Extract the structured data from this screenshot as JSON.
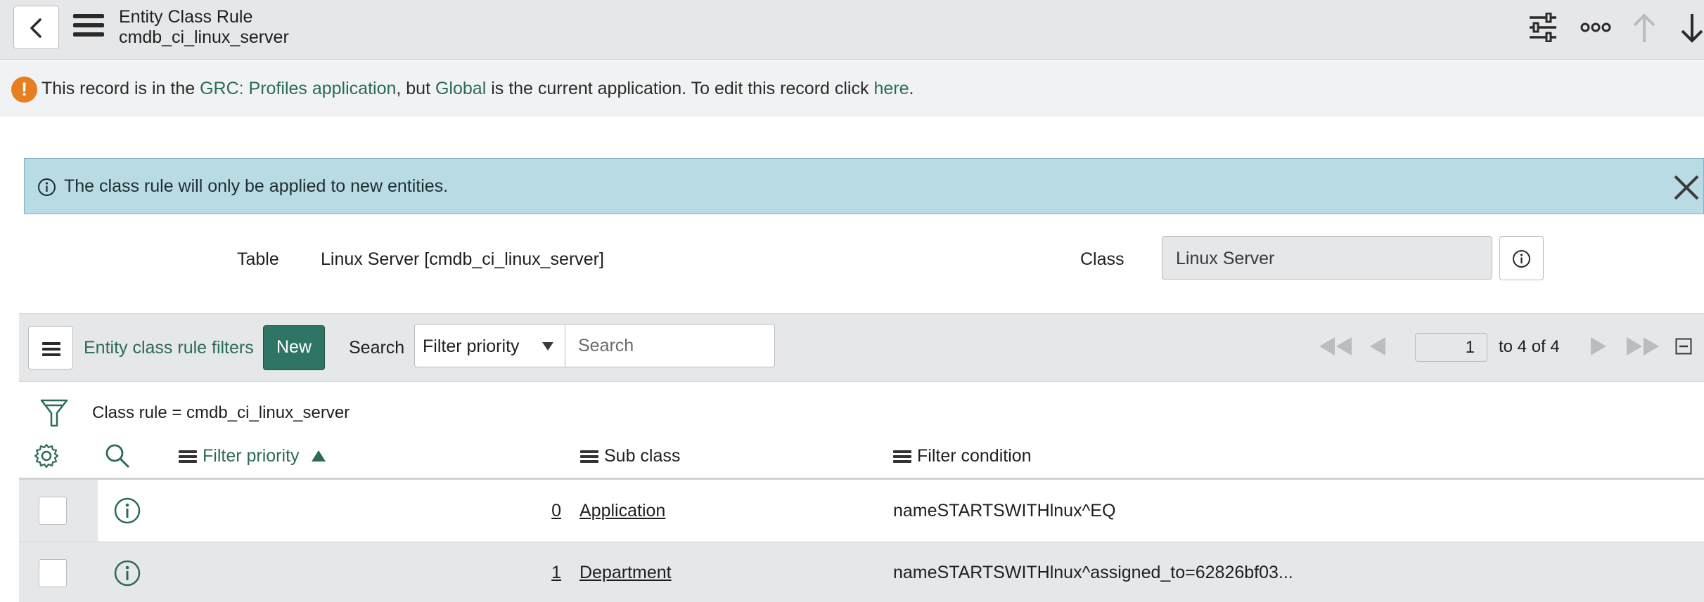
{
  "header": {
    "title": "Entity Class Rule",
    "subtitle": "cmdb_ci_linux_server"
  },
  "warning": {
    "prefix": "This record is in the ",
    "app_link": "GRC: Profiles application",
    "middle": ", but ",
    "current_link": "Global",
    "middle2": " is the current application. To edit this record click ",
    "here_link": "here",
    "suffix": "."
  },
  "info_banner": {
    "text": "The class rule will only be applied to new entities."
  },
  "form": {
    "table_label": "Table",
    "table_value": "Linux Server [cmdb_ci_linux_server]",
    "class_label": "Class",
    "class_value": "Linux Server"
  },
  "list": {
    "title": "Entity class rule filters",
    "new_label": "New",
    "search_label": "Search",
    "search_field": "Filter priority",
    "search_placeholder": "Search",
    "page_value": "1",
    "page_of": "to 4 of 4",
    "breadcrumb": "Class rule = cmdb_ci_linux_server",
    "columns": {
      "filter_priority": "Filter priority",
      "sub_class": "Sub class",
      "filter_condition": "Filter condition"
    },
    "rows": [
      {
        "priority": "0",
        "sub_class": "Application",
        "condition": "nameSTARTSWITHlnux^EQ"
      },
      {
        "priority": "1",
        "sub_class": "Department",
        "condition": "nameSTARTSWITHlnux^assigned_to=62826bf03..."
      }
    ]
  },
  "colors": {
    "accent": "#2b6a58",
    "new_button": "#2f7565",
    "warning_icon": "#e67e22",
    "info_banner": "#b9dbe3",
    "header_bg": "#e6e7e9"
  },
  "icons": {
    "back": "chevron-left-icon",
    "menu": "hamburger-icon",
    "settings": "sliders-icon",
    "more": "more-options-icon",
    "up": "arrow-up-icon",
    "down": "arrow-down-icon"
  }
}
